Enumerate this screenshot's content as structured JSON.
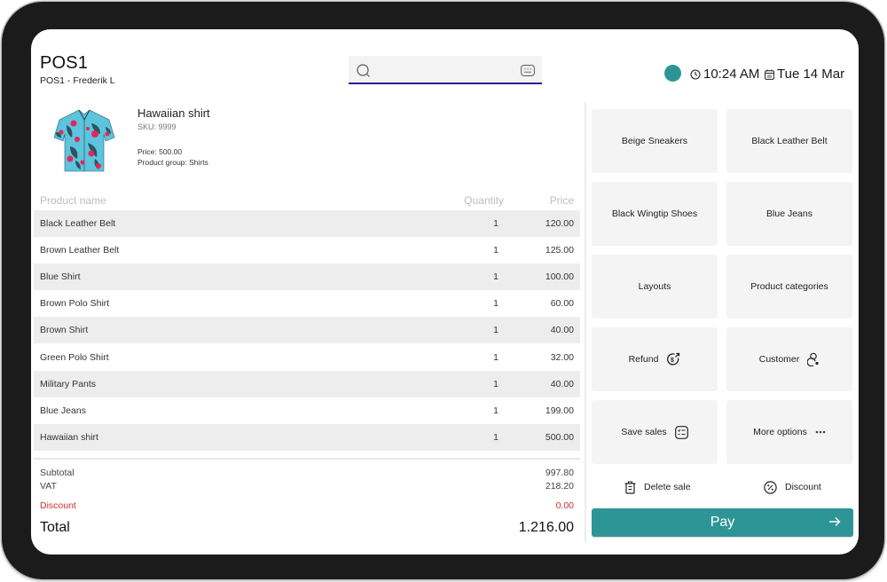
{
  "header": {
    "title": "POS1",
    "subtitle": "POS1 - Frederik L",
    "search": {
      "value": "",
      "placeholder": ""
    },
    "status_color": "#2e9596",
    "time": "10:24 AM",
    "date": "Tue 14 Mar"
  },
  "product": {
    "name": "Hawaiian shirt",
    "sku": "SKU: 9999",
    "price": "Price: 500.00",
    "group": "Product group: Shirts",
    "image_icon": "hawaiian-shirt-image"
  },
  "table": {
    "columns": {
      "name": "Product name",
      "quantity": "Quantity",
      "price": "Price"
    },
    "rows": [
      {
        "name": "Black Leather Belt",
        "quantity": "1",
        "price": "120.00"
      },
      {
        "name": "Brown Leather Belt",
        "quantity": "1",
        "price": "125.00"
      },
      {
        "name": "Blue Shirt",
        "quantity": "1",
        "price": "100.00"
      },
      {
        "name": "Brown Polo Shirt",
        "quantity": "1",
        "price": "60.00"
      },
      {
        "name": "Brown Shirt",
        "quantity": "1",
        "price": "40.00"
      },
      {
        "name": "Green Polo Shirt",
        "quantity": "1",
        "price": "32.00"
      },
      {
        "name": "Military Pants",
        "quantity": "1",
        "price": "40.00"
      },
      {
        "name": "Blue Jeans",
        "quantity": "1",
        "price": "199.00"
      },
      {
        "name": "Hawaiian shirt",
        "quantity": "1",
        "price": "500.00"
      }
    ]
  },
  "totals": {
    "subtotal_label": "Subtotal",
    "subtotal": "997.80",
    "vat_label": "VAT",
    "vat": "218.20",
    "discount_label": "Discount",
    "discount": "0.00",
    "total_label": "Total",
    "total": "1.216.00",
    "discount_color": "#d32f2f"
  },
  "tiles": [
    {
      "label": "Beige Sneakers"
    },
    {
      "label": "Black Leather Belt"
    },
    {
      "label": "Black Wingtip Shoes"
    },
    {
      "label": "Blue Jeans"
    },
    {
      "label": "Layouts"
    },
    {
      "label": "Product categories"
    },
    {
      "label": "Refund",
      "icon": "refund-icon"
    },
    {
      "label": "Customer",
      "icon": "customer-icon"
    },
    {
      "label": "Save sales",
      "icon": "save-sales-icon"
    },
    {
      "label": "More options",
      "icon": "more-options-icon"
    }
  ],
  "actions": {
    "delete_sale": "Delete sale",
    "discount": "Discount"
  },
  "pay": {
    "label": "Pay",
    "color": "#2e9596"
  }
}
